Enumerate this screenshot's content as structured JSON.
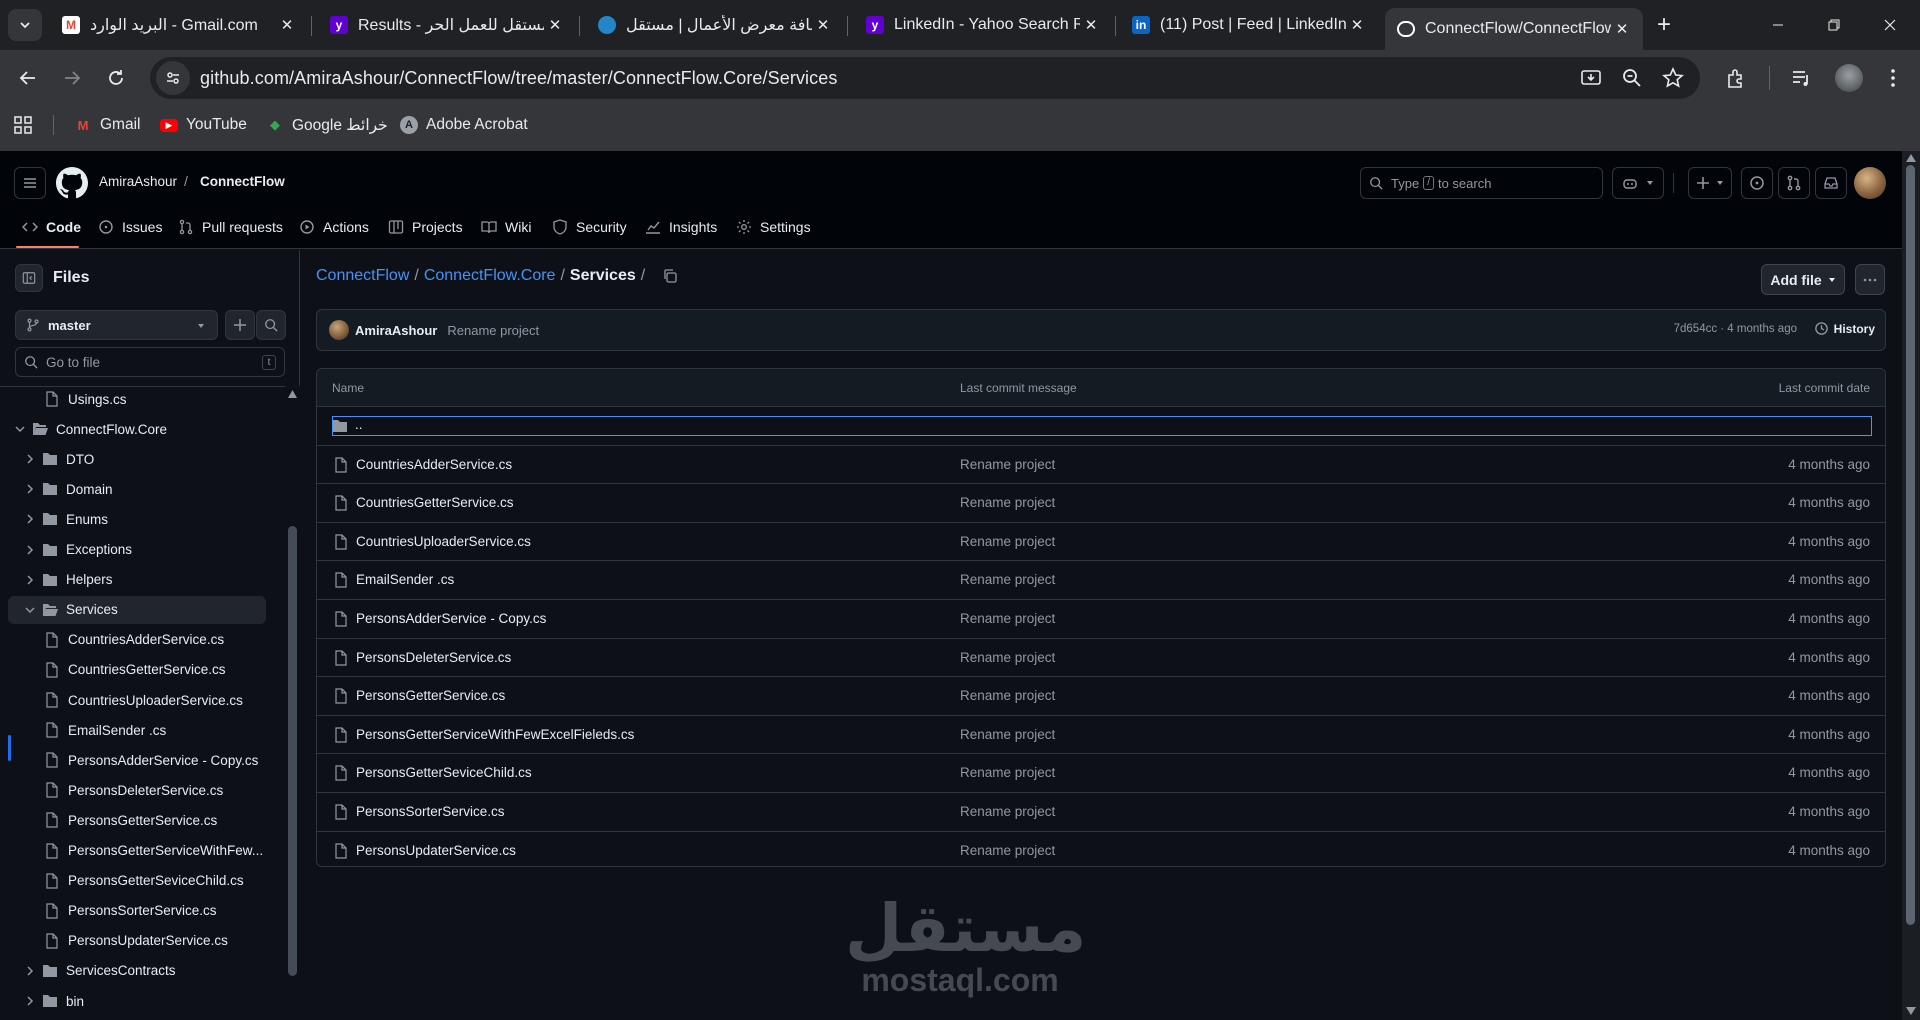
{
  "browser": {
    "tabs": [
      {
        "title": "البريد الوارد - Gmail.com",
        "favicon": "gmail-icon",
        "color": "#ea4335"
      },
      {
        "title": "Results - مستقل للعمل الحر",
        "favicon": "yahoo-icon",
        "color": "#6001d2"
      },
      {
        "title": "إضافة معرض الأعمال | مستقل",
        "favicon": "mostaql-icon",
        "color": "#2386c8"
      },
      {
        "title": "LinkedIn - Yahoo Search Re",
        "favicon": "yahoo-icon",
        "color": "#6001d2"
      },
      {
        "title": "(11) Post | Feed | LinkedIn",
        "favicon": "linkedin-icon",
        "color": "#0a66c2"
      },
      {
        "title": "ConnectFlow/ConnectFlow",
        "favicon": "github-icon",
        "color": "#ffffff",
        "active": true
      }
    ],
    "url": "github.com/AmiraAshour/ConnectFlow/tree/master/ConnectFlow.Core/Services",
    "bookmarks": [
      {
        "label": "Gmail",
        "icon": "gmail-icon"
      },
      {
        "label": "YouTube",
        "icon": "youtube-icon"
      },
      {
        "label": "Google خرائط",
        "icon": "maps-icon"
      },
      {
        "label": "Adobe Acrobat",
        "icon": "acrobat-icon"
      }
    ]
  },
  "github": {
    "owner": "AmiraAshour",
    "repo": "ConnectFlow",
    "search_placeholder_pre": "Type",
    "search_placeholder_key": "/",
    "search_placeholder_post": "to search",
    "nav": [
      {
        "label": "Code",
        "icon": "code-icon"
      },
      {
        "label": "Issues",
        "icon": "issue-icon"
      },
      {
        "label": "Pull requests",
        "icon": "pull-request-icon"
      },
      {
        "label": "Actions",
        "icon": "actions-icon"
      },
      {
        "label": "Projects",
        "icon": "projects-icon"
      },
      {
        "label": "Wiki",
        "icon": "wiki-icon"
      },
      {
        "label": "Security",
        "icon": "shield-icon"
      },
      {
        "label": "Insights",
        "icon": "graph-icon"
      },
      {
        "label": "Settings",
        "icon": "gear-icon"
      }
    ]
  },
  "sidebar": {
    "title": "Files",
    "branch": "master",
    "goto_placeholder": "Go to file",
    "goto_key": "t",
    "tree": [
      {
        "label": "Usings.cs",
        "type": "file",
        "depth": 2
      },
      {
        "label": "ConnectFlow.Core",
        "type": "folder-open",
        "depth": 0
      },
      {
        "label": "DTO",
        "type": "folder",
        "depth": 1
      },
      {
        "label": "Domain",
        "type": "folder",
        "depth": 1
      },
      {
        "label": "Enums",
        "type": "folder",
        "depth": 1
      },
      {
        "label": "Exceptions",
        "type": "folder",
        "depth": 1
      },
      {
        "label": "Helpers",
        "type": "folder",
        "depth": 1
      },
      {
        "label": "Services",
        "type": "folder-open",
        "depth": 1,
        "selected": true
      },
      {
        "label": "CountriesAdderService.cs",
        "type": "file",
        "depth": 2
      },
      {
        "label": "CountriesGetterService.cs",
        "type": "file",
        "depth": 2
      },
      {
        "label": "CountriesUploaderService.cs",
        "type": "file",
        "depth": 2
      },
      {
        "label": "EmailSender .cs",
        "type": "file",
        "depth": 2
      },
      {
        "label": "PersonsAdderService - Copy.cs",
        "type": "file",
        "depth": 2
      },
      {
        "label": "PersonsDeleterService.cs",
        "type": "file",
        "depth": 2
      },
      {
        "label": "PersonsGetterService.cs",
        "type": "file",
        "depth": 2
      },
      {
        "label": "PersonsGetterServiceWithFew...",
        "type": "file",
        "depth": 2
      },
      {
        "label": "PersonsGetterSeviceChild.cs",
        "type": "file",
        "depth": 2
      },
      {
        "label": "PersonsSorterService.cs",
        "type": "file",
        "depth": 2
      },
      {
        "label": "PersonsUpdaterService.cs",
        "type": "file",
        "depth": 2
      },
      {
        "label": "ServicesContracts",
        "type": "folder",
        "depth": 1
      },
      {
        "label": "bin",
        "type": "folder",
        "depth": 1
      }
    ]
  },
  "main": {
    "breadcrumb": {
      "root": "ConnectFlow",
      "parent": "ConnectFlow.Core",
      "current": "Services",
      "trail": "/"
    },
    "add_file": "Add file",
    "commit": {
      "author": "AmiraAshour",
      "message": "Rename project",
      "meta": "7d654cc · 4 months ago",
      "history": "History"
    },
    "table": {
      "headers": {
        "name": "Name",
        "message": "Last commit message",
        "date": "Last commit date"
      },
      "parent_row": "..",
      "rows": [
        {
          "name": "CountriesAdderService.cs",
          "message": "Rename project",
          "date": "4 months ago"
        },
        {
          "name": "CountriesGetterService.cs",
          "message": "Rename project",
          "date": "4 months ago"
        },
        {
          "name": "CountriesUploaderService.cs",
          "message": "Rename project",
          "date": "4 months ago"
        },
        {
          "name": "EmailSender .cs",
          "message": "Rename project",
          "date": "4 months ago"
        },
        {
          "name": "PersonsAdderService - Copy.cs",
          "message": "Rename project",
          "date": "4 months ago"
        },
        {
          "name": "PersonsDeleterService.cs",
          "message": "Rename project",
          "date": "4 months ago"
        },
        {
          "name": "PersonsGetterService.cs",
          "message": "Rename project",
          "date": "4 months ago"
        },
        {
          "name": "PersonsGetterServiceWithFewExcelFieleds.cs",
          "message": "Rename project",
          "date": "4 months ago"
        },
        {
          "name": "PersonsGetterSeviceChild.cs",
          "message": "Rename project",
          "date": "4 months ago"
        },
        {
          "name": "PersonsSorterService.cs",
          "message": "Rename project",
          "date": "4 months ago"
        },
        {
          "name": "PersonsUpdaterService.cs",
          "message": "Rename project",
          "date": "4 months ago"
        }
      ]
    }
  },
  "watermark": {
    "arabic": "مستقل",
    "latin": "mostaql.com"
  },
  "colors": {
    "accent": "#4493f8",
    "bg": "#0d1117",
    "header": "#010409",
    "border": "#30363d",
    "nav_underline": "#f78166"
  }
}
